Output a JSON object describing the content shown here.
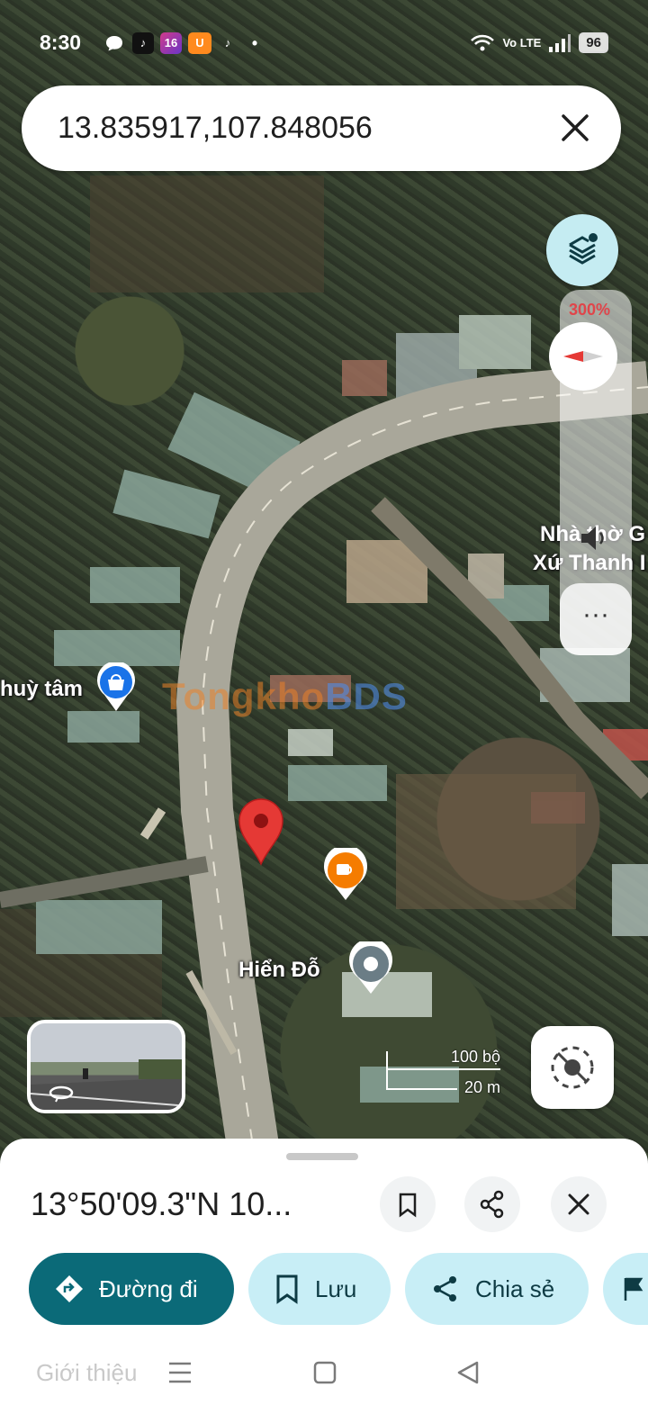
{
  "status_bar": {
    "time": "8:30",
    "notification_badge": "16",
    "network": "Vo LTE",
    "battery": "96"
  },
  "search": {
    "value": "13.835917,107.848056"
  },
  "map": {
    "zoom_level": "300%",
    "labels": {
      "place_left": "huỳ tâm",
      "church_line1": "Nhà thờ G",
      "church_line2": "Xứ Thanh I",
      "place_bottom": "Hiển Đỗ"
    },
    "scale": {
      "imperial": "100 bộ",
      "metric": "20 m"
    },
    "watermark": {
      "part1": "Tongkho",
      "part2": "BDS"
    }
  },
  "sheet": {
    "title": "13°50'09.3\"N 10...",
    "actions": {
      "directions": "Đường đi",
      "save": "Lưu",
      "share": "Chia sẻ"
    },
    "tab_intro": "Giới thiệu"
  },
  "colors": {
    "pin_red": "#e53935",
    "directions_teal": "#0b6a78",
    "tonal_blue": "#c8eef6",
    "cafe_orange": "#f57c00",
    "shop_blue": "#1a73e8"
  }
}
